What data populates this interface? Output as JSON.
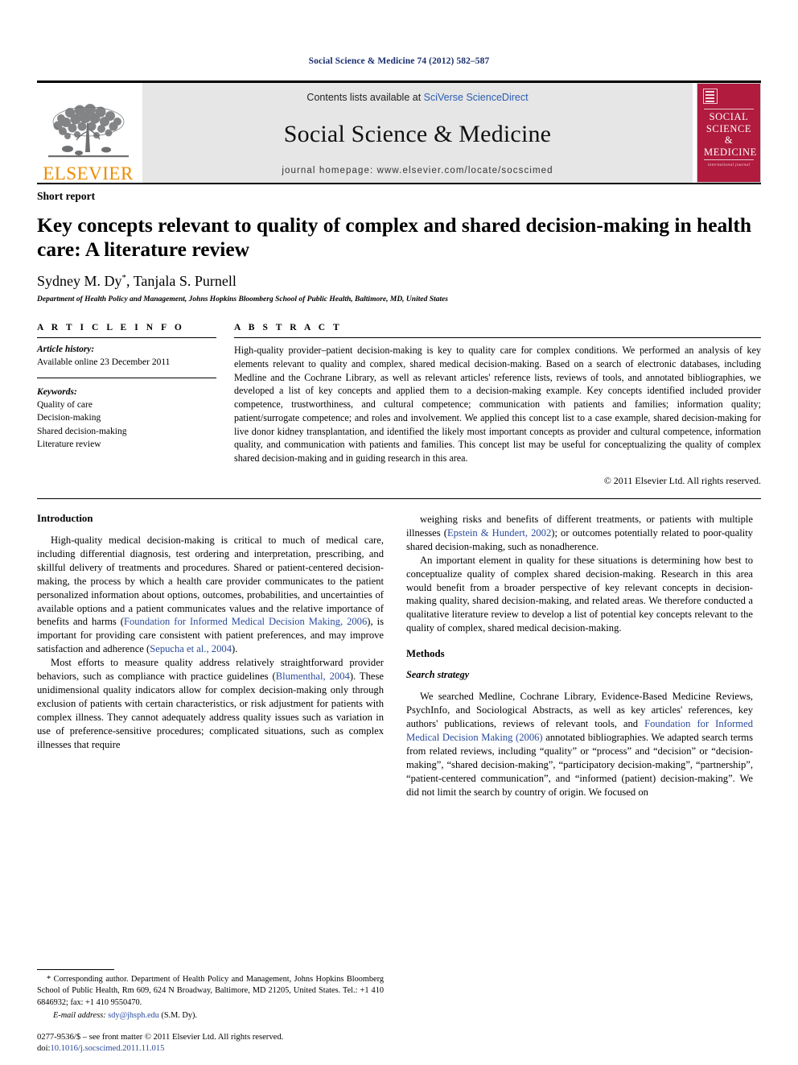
{
  "running_head": "Social Science & Medicine 74 (2012) 582–587",
  "masthead": {
    "publisher_name": "ELSEVIER",
    "contents_prefix": "Contents lists available at ",
    "contents_link": "SciVerse ScienceDirect",
    "journal_name": "Social Science & Medicine",
    "homepage": "journal homepage: www.elsevier.com/locate/socscimed",
    "cover": {
      "title_line1": "SOCIAL",
      "title_line2": "SCIENCE",
      "title_line3": "&",
      "title_line4": "MEDICINE",
      "subtitle": "international journal"
    },
    "colors": {
      "elsevier_orange": "#ED8B00",
      "cover_red": "#b01b3e",
      "box_grey": "#e6e6e6",
      "link_blue": "#2a5db0"
    }
  },
  "article": {
    "doctype": "Short report",
    "title": "Key concepts relevant to quality of complex and shared decision-making in health care: A literature review",
    "authors": "Sydney M. Dy",
    "authors_rest": ", Tanjala S. Purnell",
    "corresponding_marker": "*",
    "affiliation": "Department of Health Policy and Management, Johns Hopkins Bloomberg School of Public Health, Baltimore, MD, United States"
  },
  "article_info": {
    "heading": "A R T I C L E   I N F O",
    "history_label": "Article history:",
    "history_value": "Available online 23 December 2011",
    "keywords_label": "Keywords:",
    "keywords": [
      "Quality of care",
      "Decision-making",
      "Shared decision-making",
      "Literature review"
    ]
  },
  "abstract": {
    "heading": "A B S T R A C T",
    "text": "High-quality provider–patient decision-making is key to quality care for complex conditions. We performed an analysis of key elements relevant to quality and complex, shared medical decision-making. Based on a search of electronic databases, including Medline and the Cochrane Library, as well as relevant articles' reference lists, reviews of tools, and annotated bibliographies, we developed a list of key concepts and applied them to a decision-making example. Key concepts identified included provider competence, trustworthiness, and cultural competence; communication with patients and families; information quality; patient/surrogate competence; and roles and involvement. We applied this concept list to a case example, shared decision-making for live donor kidney transplantation, and identified the likely most important concepts as provider and cultural competence, information quality, and communication with patients and families. This concept list may be useful for conceptualizing the quality of complex shared decision-making and in guiding research in this area.",
    "copyright": "© 2011 Elsevier Ltd. All rights reserved."
  },
  "left_column": {
    "intro_heading": "Introduction",
    "para1_a": "High-quality medical decision-making is critical to much of medical care, including differential diagnosis, test ordering and interpretation, prescribing, and skillful delivery of treatments and procedures. Shared or patient-centered decision-making, the process by which a health care provider communicates to the patient personalized information about options, outcomes, probabilities, and uncertainties of available options and a patient communicates values and the relative importance of benefits and harms (",
    "para1_cite1": "Foundation for Informed Medical Decision Making, 2006",
    "para1_b": "), is important for providing care consistent with patient preferences, and may improve satisfaction and adherence (",
    "para1_cite2": "Sepucha et al., 2004",
    "para1_c": ").",
    "para2_a": "Most efforts to measure quality address relatively straightforward provider behaviors, such as compliance with practice guidelines (",
    "para2_cite1": "Blumenthal, 2004",
    "para2_b": "). These unidimensional quality indicators allow for complex decision-making only through exclusion of patients with certain characteristics, or risk adjustment for patients with complex illness. They cannot adequately address quality issues such as variation in use of preference-sensitive procedures; complicated situations, such as complex illnesses that require"
  },
  "right_column": {
    "para1_a": "weighing risks and benefits of different treatments, or patients with multiple illnesses (",
    "para1_cite1": "Epstein & Hundert, 2002",
    "para1_b": "); or outcomes potentially related to poor-quality shared decision-making, such as nonadherence.",
    "para2": "An important element in quality for these situations is determining how best to conceptualize quality of complex shared decision-making. Research in this area would benefit from a broader perspective of key relevant concepts in decision-making quality, shared decision-making, and related areas. We therefore conducted a qualitative literature review to develop a list of potential key concepts relevant to the quality of complex, shared medical decision-making.",
    "methods_heading": "Methods",
    "search_subheading": "Search strategy",
    "para3_a": "We searched Medline, Cochrane Library, Evidence-Based Medicine Reviews, PsychInfo, and Sociological Abstracts, as well as key articles' references, key authors' publications, reviews of relevant tools, and ",
    "para3_cite1": "Foundation for Informed Medical Decision Making (2006)",
    "para3_b": " annotated bibliographies. We adapted search terms from related reviews, including “quality” or “process” and “decision” or “decision-making”, “shared decision-making”, “participatory decision-making”, “partnership”, “patient-centered communication”, and “informed (patient) decision-making”. We did not limit the search by country of origin. We focused on"
  },
  "footnote": {
    "marker": "*",
    "text": " Corresponding author. Department of Health Policy and Management, Johns Hopkins Bloomberg School of Public Health, Rm 609, 624 N Broadway, Baltimore, MD 21205, United States. Tel.: +1 410 6846932; fax: +1 410 9550470.",
    "email_label": "E-mail address:",
    "email": "sdy@jhsph.edu",
    "email_suffix": " (S.M. Dy)."
  },
  "imprint": {
    "issn_line": "0277-9536/$ – see front matter © 2011 Elsevier Ltd. All rights reserved.",
    "doi_prefix": "doi:",
    "doi": "10.1016/j.socscimed.2011.11.015"
  }
}
